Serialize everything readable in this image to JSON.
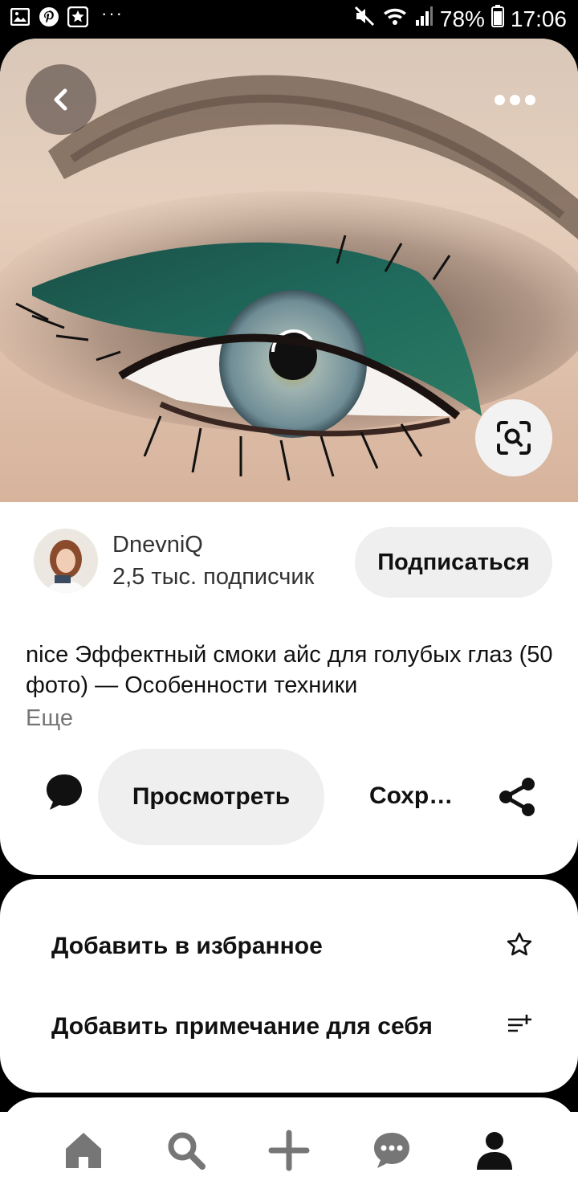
{
  "status_bar": {
    "battery": "78%",
    "time": "17:06",
    "icons_left": [
      "gallery-icon",
      "pinterest-icon",
      "star-app-icon",
      "more-dots"
    ],
    "icons_right": [
      "mute-icon",
      "wifi-icon",
      "signal-icon",
      "battery-icon"
    ]
  },
  "pin": {
    "image_desc_icon": "eye-makeup-image",
    "author": {
      "name": "DnevniQ",
      "subscribers": "2,5 тыс. подписчик"
    },
    "follow_label": "Подписаться",
    "description": "nice Эффектный смоки айс для голубых глаз (50 фото) — Особенности техники",
    "more_label": "Еще",
    "view_label": "Просмотреть",
    "save_label": "Сохр…"
  },
  "menu": {
    "items": [
      {
        "label": "Добавить в избранное",
        "icon": "star-outline-icon"
      },
      {
        "label": "Добавить примечание для себя",
        "icon": "note-add-icon"
      }
    ]
  },
  "bottom_nav": {
    "items": [
      "home-icon",
      "search-icon",
      "plus-icon",
      "messages-icon",
      "profile-icon"
    ]
  },
  "colors": {
    "eyeshadow": "#1f6a5c",
    "button_bg": "#efefef",
    "text": "#111111"
  }
}
